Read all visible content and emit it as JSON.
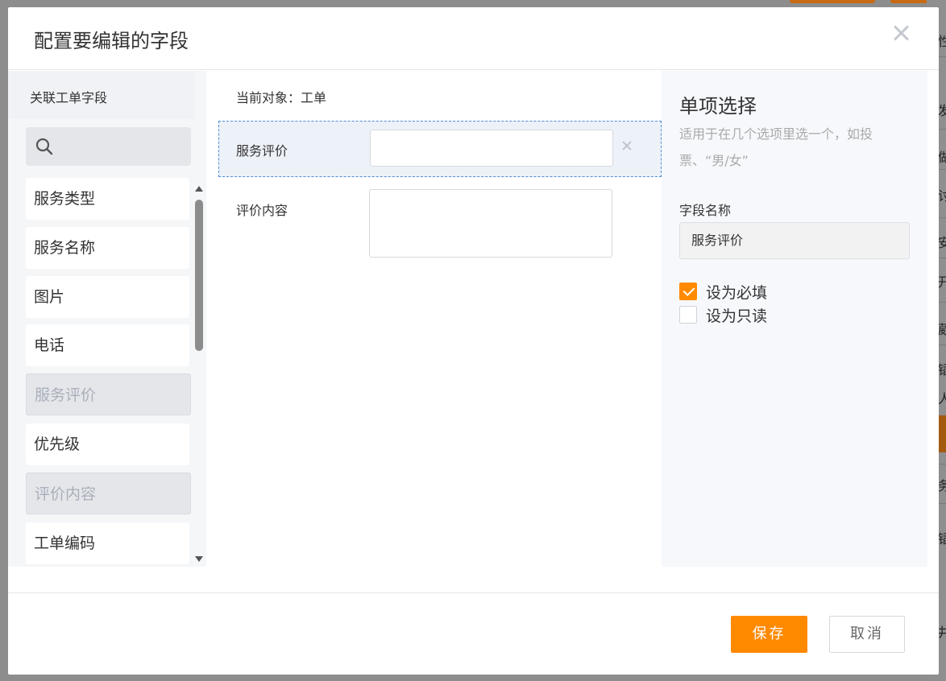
{
  "modal": {
    "title": "配置要编辑的字段"
  },
  "left": {
    "title": "关联工单字段",
    "search_placeholder": "",
    "items": [
      {
        "label": "服务类型",
        "used": false
      },
      {
        "label": "服务名称",
        "used": false
      },
      {
        "label": "图片",
        "used": false
      },
      {
        "label": "电话",
        "used": false
      },
      {
        "label": "服务评价",
        "used": true
      },
      {
        "label": "优先级",
        "used": false
      },
      {
        "label": "评价内容",
        "used": true
      },
      {
        "label": "工单编码",
        "used": false
      }
    ]
  },
  "center": {
    "current_object": "当前对象：工单",
    "fields": [
      {
        "label": "服务评价",
        "value": "",
        "selected": true
      },
      {
        "label": "评价内容",
        "value": "",
        "selected": false
      }
    ]
  },
  "right": {
    "type_title": "单项选择",
    "type_desc": "适用于在几个选项里选一个，如投票、“男/女”",
    "field_name_label": "字段名称",
    "field_name_value": "服务评价",
    "required_label": "设为必填",
    "required_checked": true,
    "readonly_label": "设为只读",
    "readonly_checked": false
  },
  "footer": {
    "save_label": "保存",
    "cancel_label": "取消"
  },
  "background": {
    "right_edge_chars": [
      "性",
      "发",
      "做",
      "讨",
      "安",
      "开",
      "葳",
      "锸",
      "人",
      "务",
      "锸",
      "井"
    ]
  },
  "colors": {
    "accent": "#ff8a00",
    "selected_row": "#edf1f8",
    "selected_border": "#4d8fd6"
  }
}
